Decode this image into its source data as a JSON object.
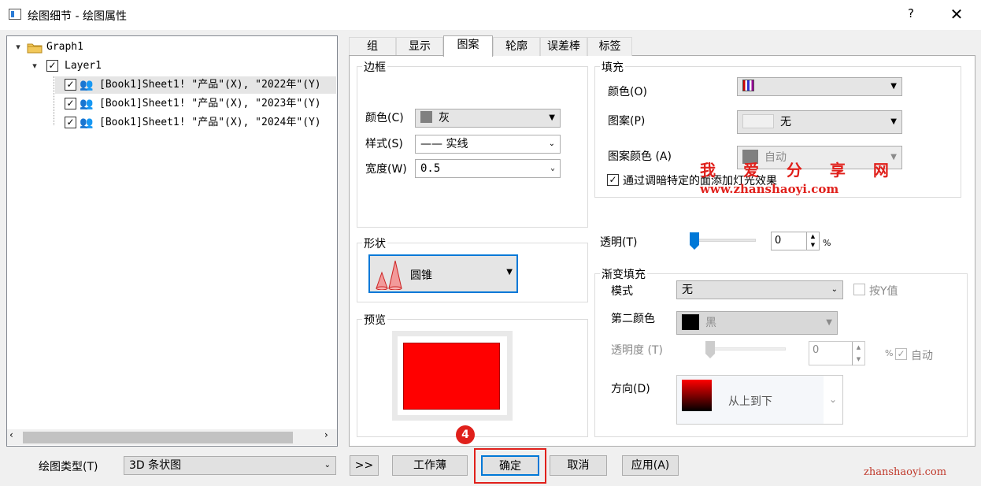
{
  "window": {
    "title": "绘图细节 - 绘图属性",
    "help": "?",
    "close": "✕"
  },
  "tree": {
    "root": "Graph1",
    "layer": "Layer1",
    "plots": [
      "[Book1]Sheet1! \"产品\"(X), \"2022年\"(Y)",
      "[Book1]Sheet1! \"产品\"(X), \"2023年\"(Y)",
      "[Book1]Sheet1! \"产品\"(X), \"2024年\"(Y)"
    ]
  },
  "tabs": [
    "组",
    "显示",
    "图案",
    "轮廓",
    "误差棒",
    "标签"
  ],
  "active_tab": "图案",
  "border": {
    "title": "边框",
    "color_label": "颜色(C)",
    "color_value": "灰",
    "style_label": "样式(S)",
    "style_value": "—— 实线",
    "width_label": "宽度(W)",
    "width_value": "0.5"
  },
  "fill": {
    "title": "填充",
    "color_label": "颜色(O)",
    "pattern_label": "图案(P)",
    "pattern_value": "无",
    "pattern_color_label": "图案颜色 (A)",
    "pattern_color_value": "自动",
    "light_effect_label": "通过调暗特定的面添加灯光效果"
  },
  "shape": {
    "title": "形状",
    "value": "圆锥"
  },
  "preview": {
    "title": "预览"
  },
  "transparency": {
    "label": "透明(T)",
    "value": "0",
    "unit": "%"
  },
  "gradient": {
    "title": "渐变填充",
    "mode_label": "模式",
    "mode_value": "无",
    "by_y_label": "按Y值",
    "second_color_label": "第二颜色",
    "second_color_value": "黑",
    "transparency_label": "透明度 (T)",
    "transparency_value": "0",
    "unit": "%",
    "auto_label": "自动",
    "direction_label": "方向(D)",
    "direction_value": "从上到下"
  },
  "bottom": {
    "plot_type_label": "绘图类型(T)",
    "plot_type_value": "3D 条状图",
    "expand": ">>",
    "workbook": "工作薄",
    "ok": "确定",
    "cancel": "取消",
    "apply": "应用(A)"
  },
  "annotation": {
    "step": "4"
  },
  "watermark": {
    "title": "我 爱 分 享 网",
    "url": "www.zhanshaoyi.com",
    "corner": "zhanshaoyi.com"
  },
  "colors": {
    "accent": "#0078d7",
    "highlight_box": "#e0201b",
    "preview_fill": "#ff0000"
  }
}
